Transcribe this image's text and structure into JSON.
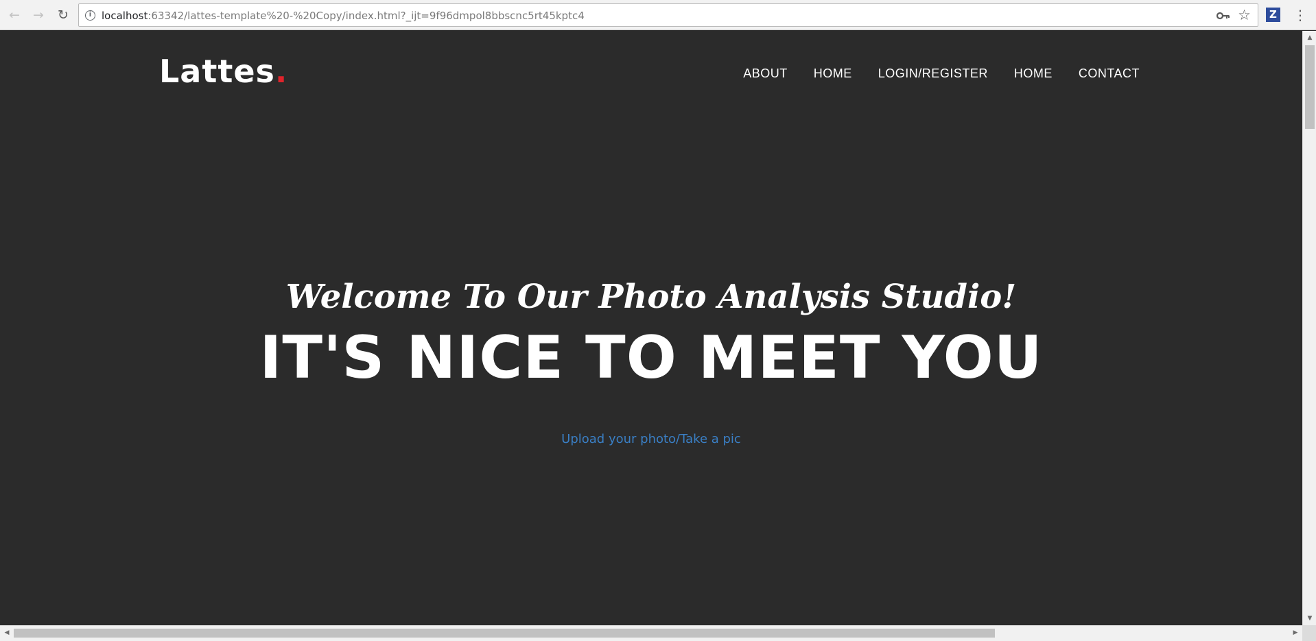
{
  "browser": {
    "url_host": "localhost",
    "url_rest": ":63342/lattes-template%20-%20Copy/index.html?_ijt=9f96dmpol8bbscnc5rt45kptc4",
    "back_icon": "arrow-left-icon",
    "forward_icon": "arrow-right-icon",
    "reload_icon": "reload-icon",
    "extension_label": "Z",
    "info_symbol": "i",
    "star_symbol": "☆",
    "menu_symbol": "⋮"
  },
  "site": {
    "logo_text": "Lattes",
    "logo_dot": ".",
    "logo_dot_color": "#e0232b"
  },
  "nav": {
    "items": [
      {
        "label": "ABOUT"
      },
      {
        "label": "HOME"
      },
      {
        "label": "LOGIN/REGISTER"
      },
      {
        "label": "HOME"
      },
      {
        "label": "CONTACT"
      }
    ]
  },
  "hero": {
    "subtitle": "Welcome To Our Photo Analysis Studio!",
    "title": "IT'S NICE TO MEET YOU",
    "link_text": "Upload your photo/Take a pic",
    "link_color": "#3a7fc5"
  },
  "colors": {
    "background": "#2b2b2b",
    "text": "#ffffff"
  }
}
